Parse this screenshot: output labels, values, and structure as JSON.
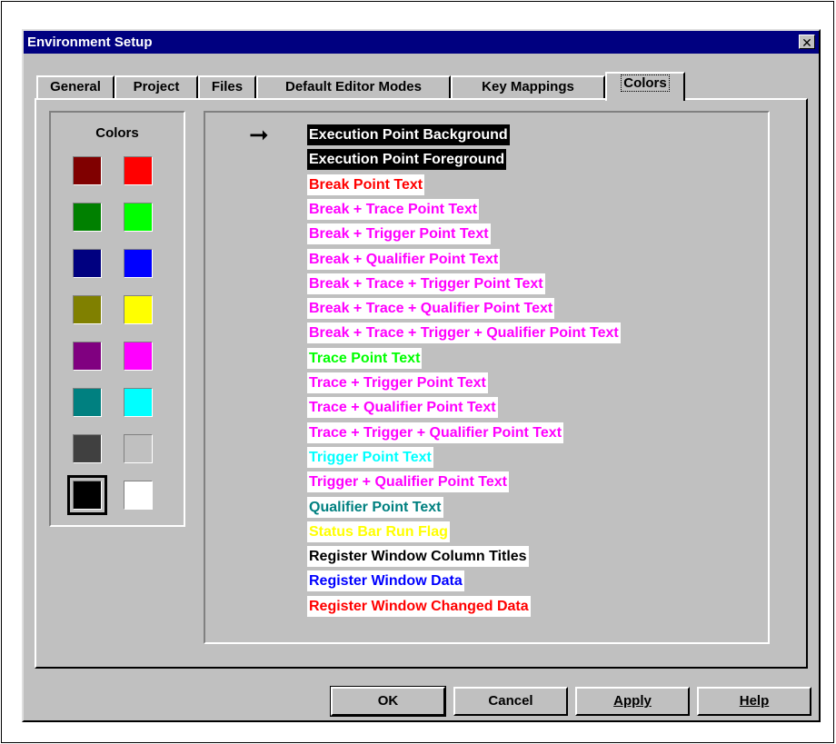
{
  "window": {
    "title": "Environment Setup",
    "close_glyph": "✕"
  },
  "tabs": [
    {
      "label": "General"
    },
    {
      "label": "Project"
    },
    {
      "label": "Files"
    },
    {
      "label": "Default Editor Modes"
    },
    {
      "label": "Key Mappings"
    },
    {
      "label": "Colors",
      "active": true
    }
  ],
  "palette": {
    "title": "Colors",
    "swatches": [
      {
        "color": "#800000"
      },
      {
        "color": "#ff0000"
      },
      {
        "color": "#008000"
      },
      {
        "color": "#00ff00"
      },
      {
        "color": "#000080"
      },
      {
        "color": "#0000ff"
      },
      {
        "color": "#808000"
      },
      {
        "color": "#ffff00"
      },
      {
        "color": "#800080"
      },
      {
        "color": "#ff00ff"
      },
      {
        "color": "#008080"
      },
      {
        "color": "#00ffff"
      },
      {
        "color": "#404040"
      },
      {
        "color": "#c0c0c0"
      },
      {
        "color": "#000000",
        "selected": true
      },
      {
        "color": "#ffffff"
      }
    ]
  },
  "selection_arrow": "➞",
  "items": [
    {
      "label": "Execution Point Background",
      "fg": "#ffffff",
      "bg": "#000000",
      "selected": true
    },
    {
      "label": "Execution Point Foreground",
      "fg": "#ffffff",
      "bg": "#000000"
    },
    {
      "label": "Break Point Text",
      "fg": "#ff0000",
      "bg": "#ffffff"
    },
    {
      "label": "Break + Trace Point Text",
      "fg": "#ff00ff",
      "bg": "#ffffff"
    },
    {
      "label": "Break + Trigger Point Text",
      "fg": "#ff00ff",
      "bg": "#ffffff"
    },
    {
      "label": "Break + Qualifier Point Text",
      "fg": "#ff00ff",
      "bg": "#ffffff"
    },
    {
      "label": "Break + Trace + Trigger Point Text",
      "fg": "#ff00ff",
      "bg": "#ffffff"
    },
    {
      "label": "Break + Trace + Qualifier Point Text",
      "fg": "#ff00ff",
      "bg": "#ffffff"
    },
    {
      "label": "Break + Trace + Trigger + Qualifier Point Text",
      "fg": "#ff00ff",
      "bg": "#ffffff"
    },
    {
      "label": "Trace Point Text",
      "fg": "#00ff00",
      "bg": "#ffffff"
    },
    {
      "label": "Trace + Trigger Point Text",
      "fg": "#ff00ff",
      "bg": "#ffffff"
    },
    {
      "label": "Trace + Qualifier Point Text",
      "fg": "#ff00ff",
      "bg": "#ffffff"
    },
    {
      "label": "Trace + Trigger + Qualifier Point Text",
      "fg": "#ff00ff",
      "bg": "#ffffff"
    },
    {
      "label": "Trigger Point Text",
      "fg": "#00ffff",
      "bg": "#ffffff"
    },
    {
      "label": "Trigger + Qualifier Point Text",
      "fg": "#ff00ff",
      "bg": "#ffffff"
    },
    {
      "label": "Qualifier Point Text",
      "fg": "#008080",
      "bg": "#ffffff"
    },
    {
      "label": "Status Bar Run Flag",
      "fg": "#ffff00",
      "bg": "#ffffff"
    },
    {
      "label": "Register Window Column Titles",
      "fg": "#000000",
      "bg": "#ffffff"
    },
    {
      "label": "Register Window Data",
      "fg": "#0000ff",
      "bg": "#ffffff"
    },
    {
      "label": "Register Window Changed Data",
      "fg": "#ff0000",
      "bg": "#ffffff"
    }
  ],
  "buttons": {
    "ok": "OK",
    "cancel": "Cancel",
    "apply": "Apply",
    "help": "Help"
  }
}
